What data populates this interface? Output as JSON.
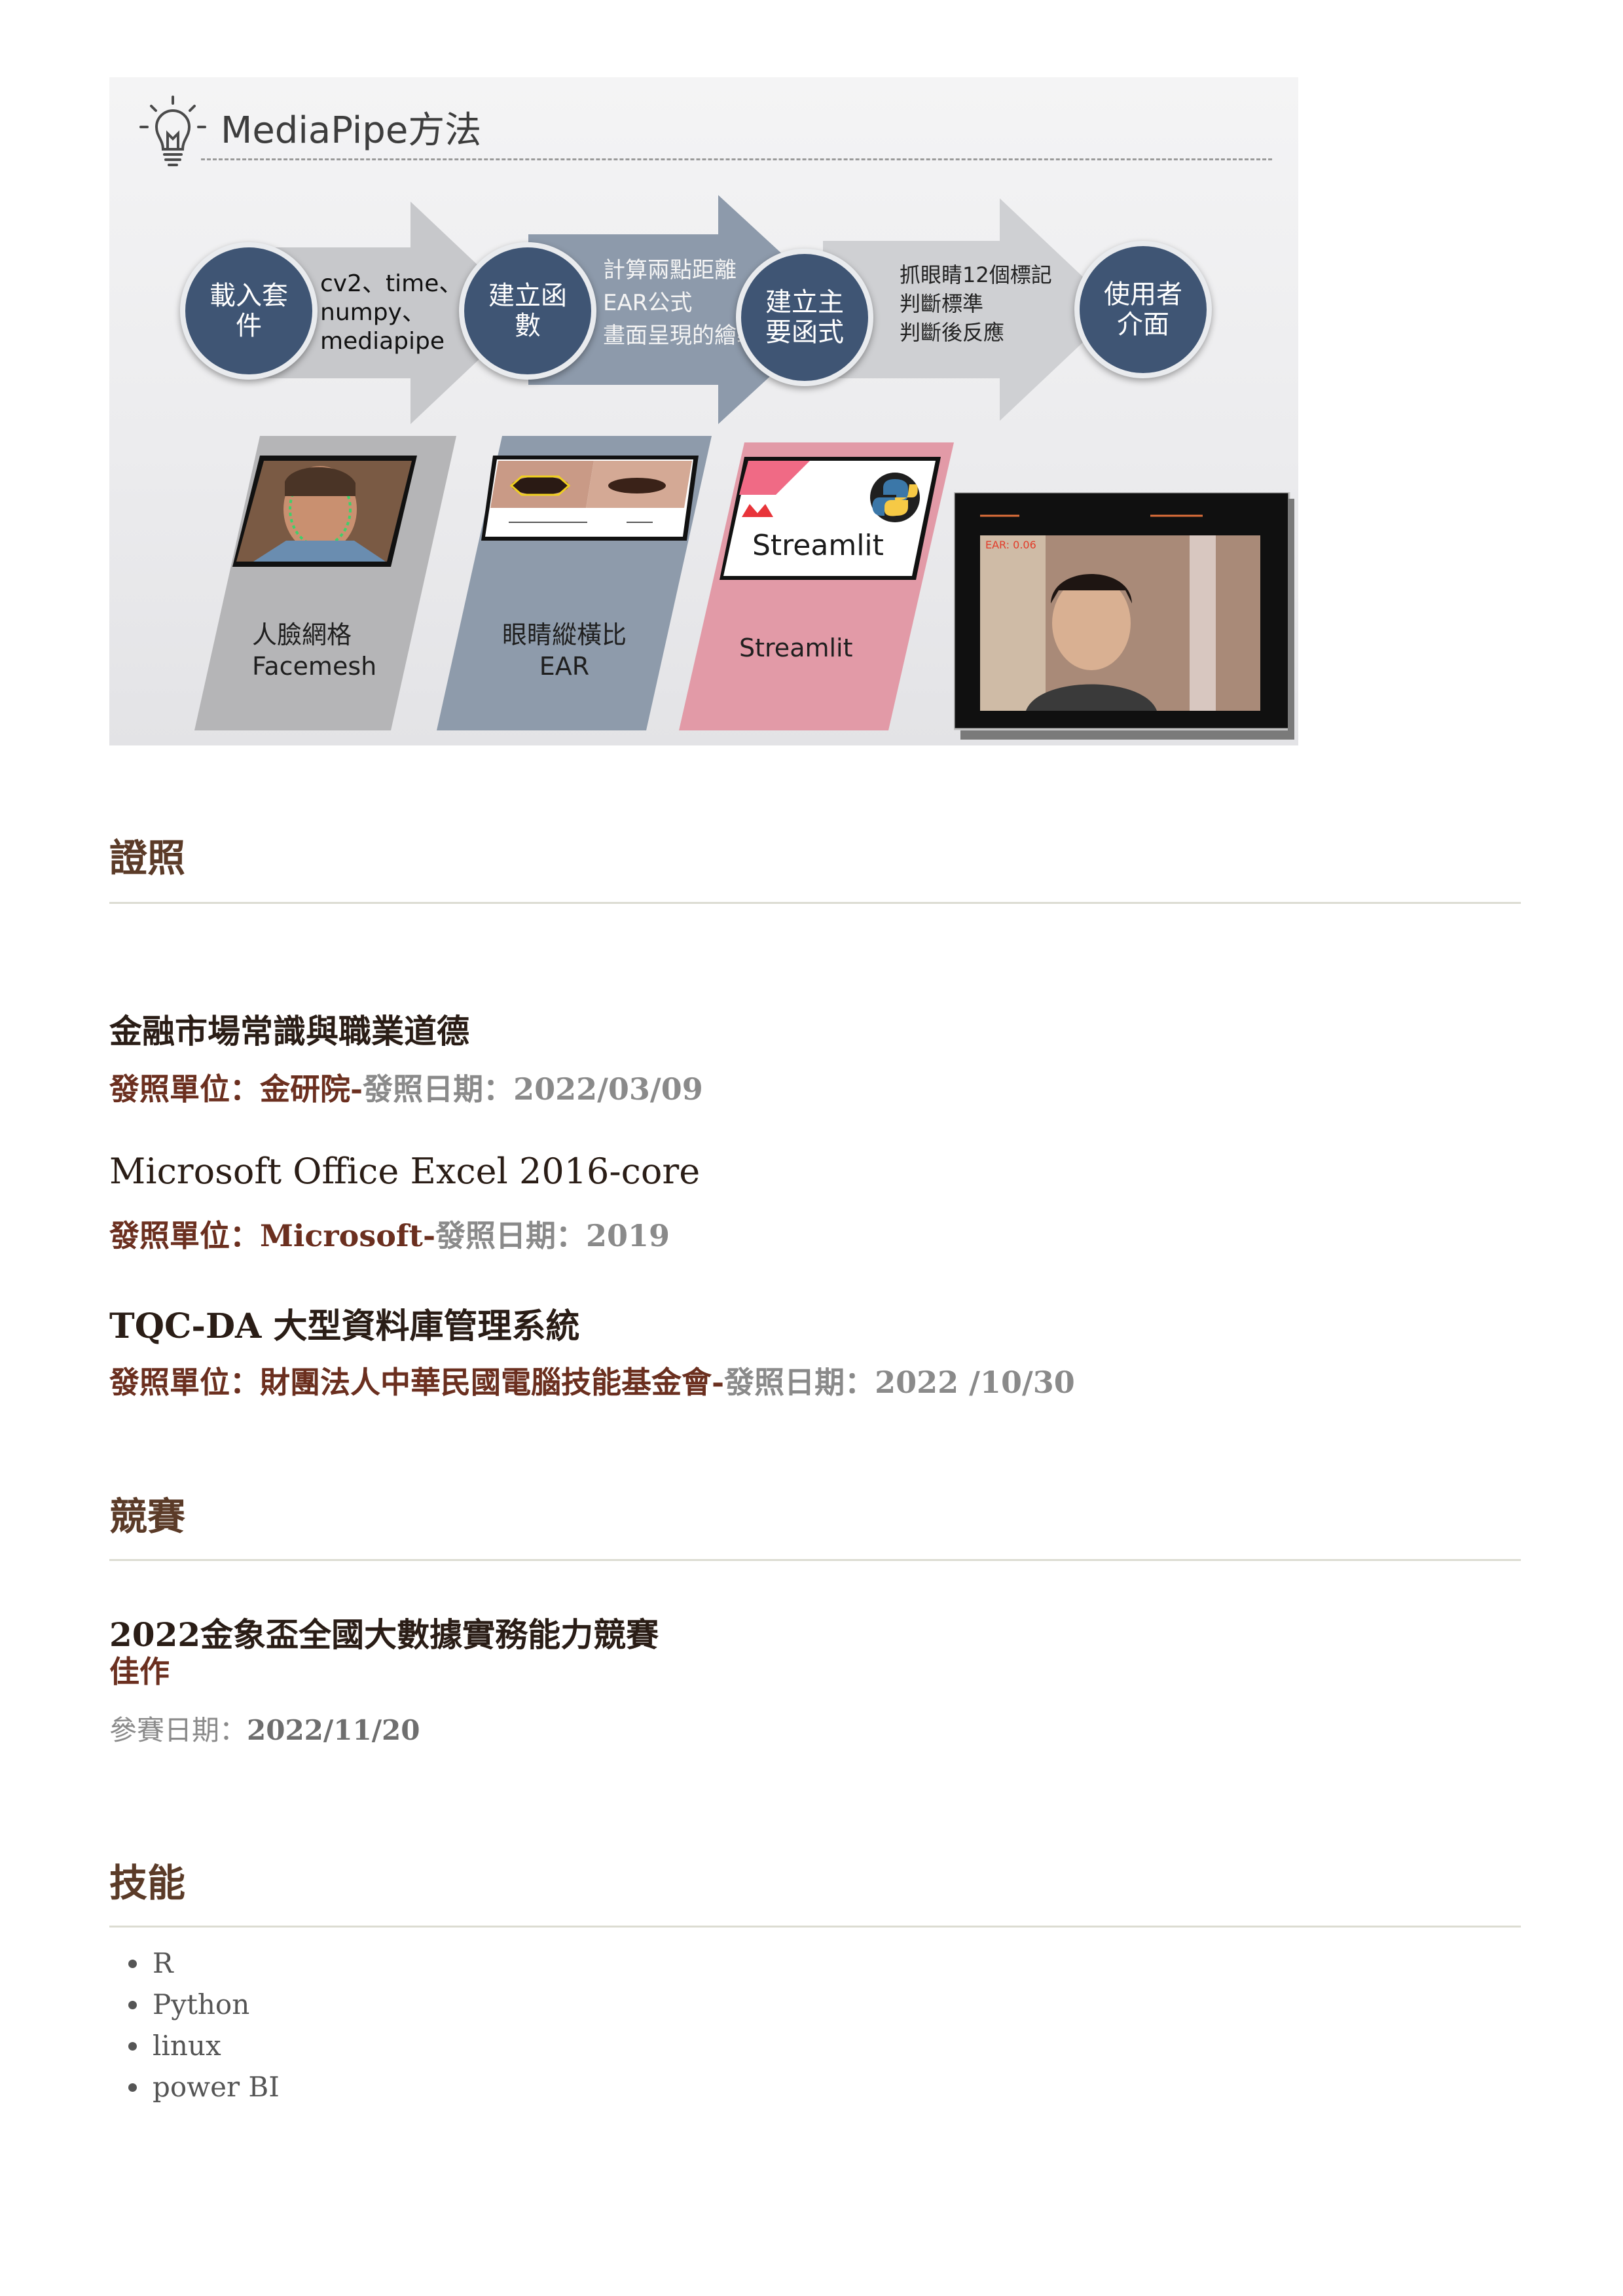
{
  "slide": {
    "title": "MediaPipe方法",
    "steps": [
      {
        "circle_lines": [
          "載入套",
          "件"
        ],
        "text_lines": [
          "cv2、time、",
          "numpy、",
          "mediapipe"
        ]
      },
      {
        "circle_lines": [
          "建立函",
          "數"
        ],
        "text_lines": [
          "計算兩點距離",
          "EAR公式",
          "畫面呈現的繪製"
        ]
      },
      {
        "circle_lines": [
          "建立主",
          "要函式"
        ],
        "text_lines": [
          "抓眼睛12個標記",
          "判斷標準",
          "判斷後反應"
        ]
      },
      {
        "circle_lines": [
          "使用者",
          "介面"
        ],
        "text_lines": []
      }
    ],
    "cards": [
      {
        "lines": [
          "人臉網格",
          "Facemesh"
        ]
      },
      {
        "lines": [
          "眼睛縱橫比",
          "EAR"
        ]
      },
      {
        "lines": [
          "Streamlit"
        ]
      }
    ],
    "streamlit_logo_text": "Streamlit",
    "ear_readout": "EAR: 0.06",
    "colors": {
      "circle": "#3f5574",
      "card1": "#b5b5b7",
      "card2": "#8e9bab",
      "card3": "#e29aa7",
      "arrow1": "#c7c8cb",
      "arrow2": "#8d9aab"
    }
  },
  "certificates": {
    "heading": "證照",
    "items": [
      {
        "title": "金融市場常識與職業道德",
        "org": "發照單位：金研院",
        "sep": "-",
        "date": "發照日期：2022/03/09"
      },
      {
        "title": "Microsoft Office Excel 2016-core",
        "org": "發照單位：Microsoft",
        "sep": "-",
        "date": "發照日期：2019"
      },
      {
        "title": "TQC-DA 大型資料庫管理系統",
        "org": "發照單位：財團法人中華民國電腦技能基金會",
        "sep": "-",
        "date": "發照日期：2022 /10/30"
      }
    ]
  },
  "competitions": {
    "heading": "競賽",
    "title": "2022金象盃全國大數據實務能力競賽",
    "award": "佳作",
    "date_label": "參賽日期：",
    "date_value": "2022/11/20"
  },
  "skills": {
    "heading": "技能",
    "items": [
      "R",
      "Python",
      "linux",
      "power BI"
    ]
  }
}
